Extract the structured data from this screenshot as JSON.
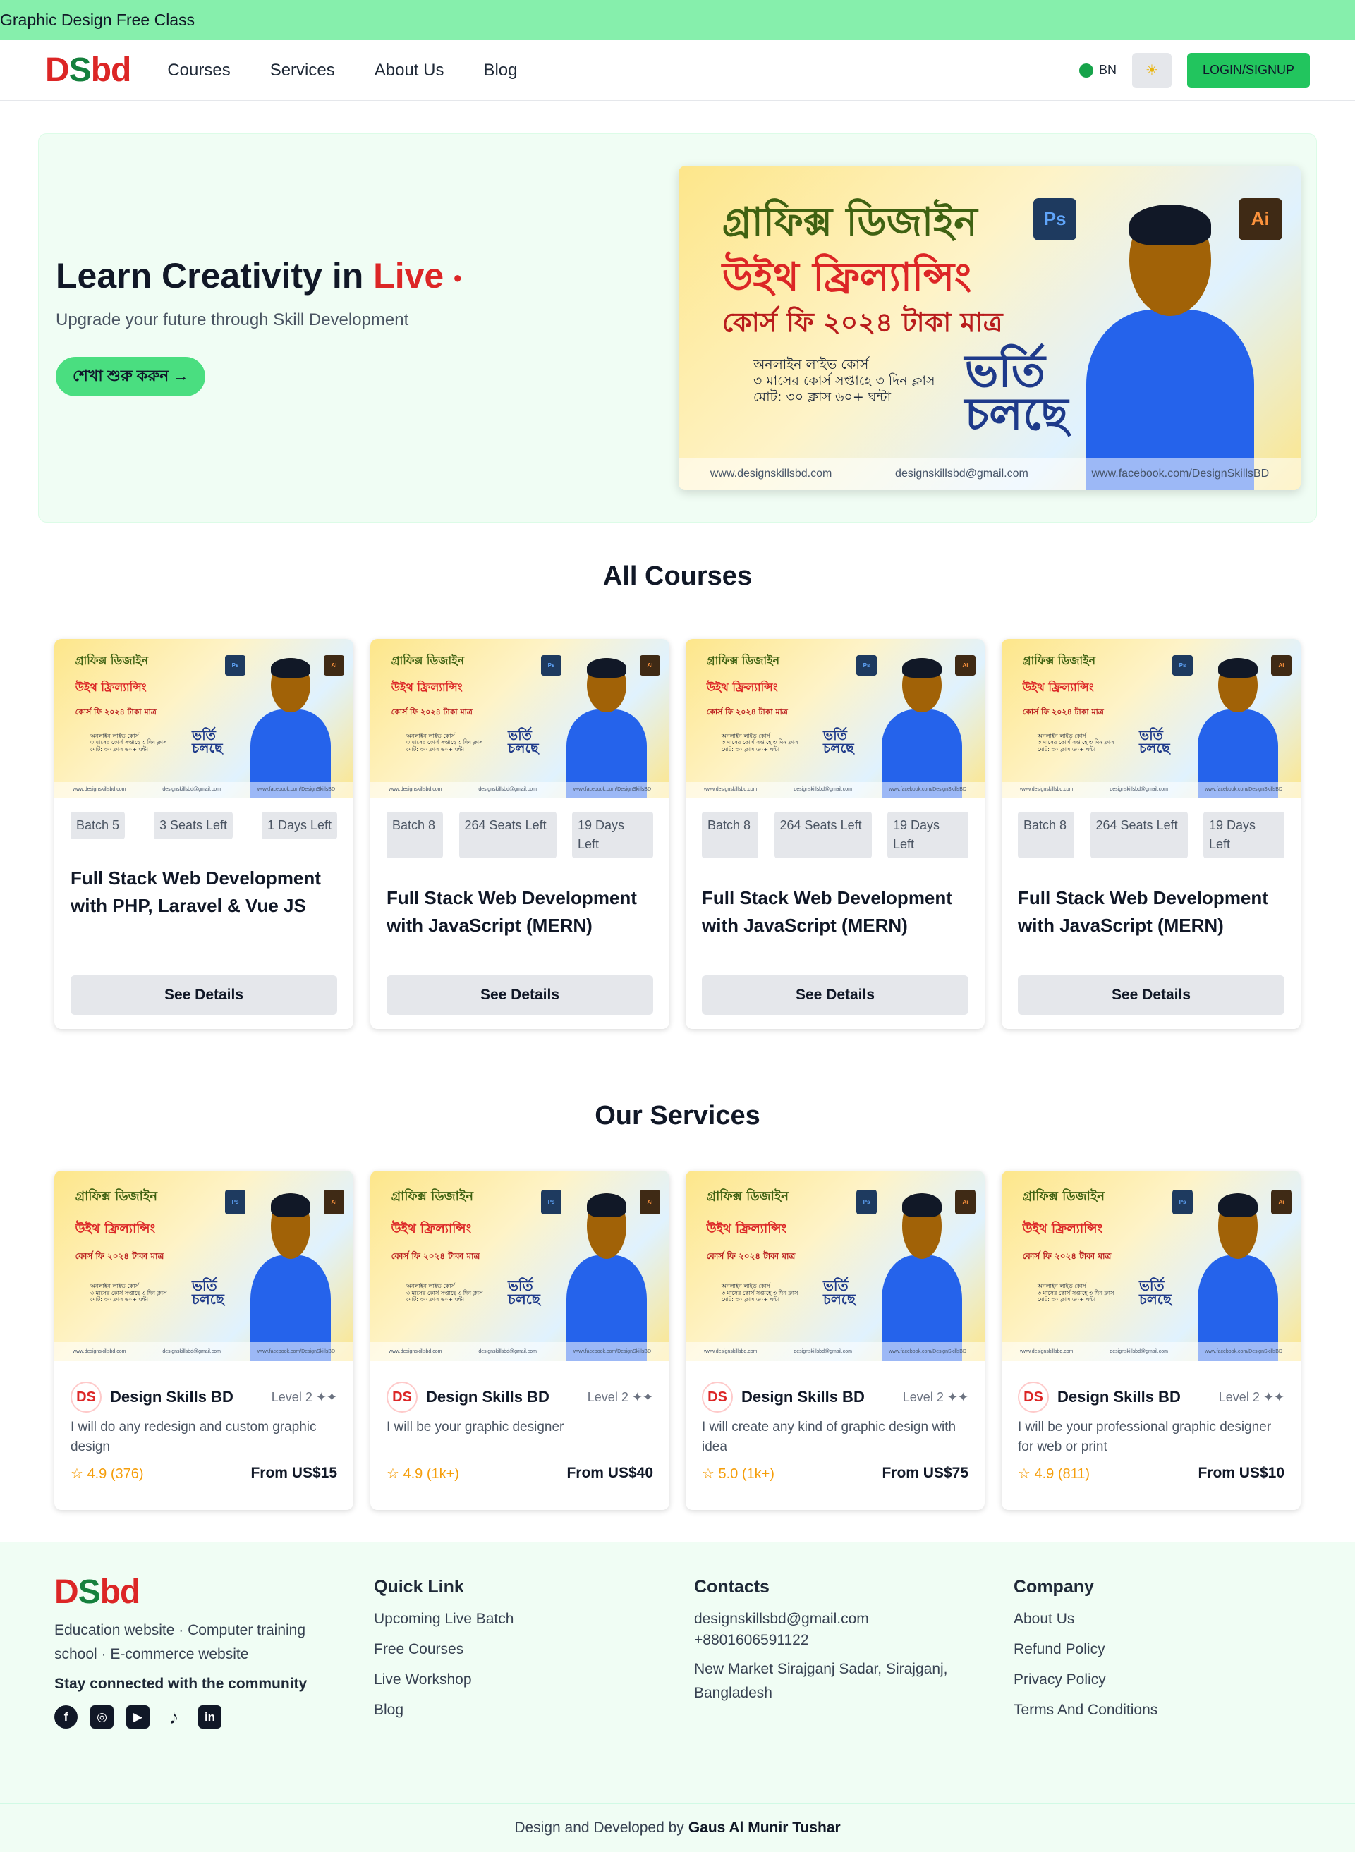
{
  "topbar": {
    "text": "Graphic Design Free Class"
  },
  "nav": {
    "logo": {
      "d": "D",
      "s": "S",
      "bd": "bd"
    },
    "links": [
      "Courses",
      "Services",
      "About Us",
      "Blog"
    ],
    "lang": "BN",
    "theme_icon": "☀",
    "login": "LOGIN/SIGNUP"
  },
  "hero": {
    "title_part1": "Learn Creativity in ",
    "title_live": "Live",
    "title_dot": "•",
    "subtitle": "Upgrade your future through Skill Development",
    "cta": "শেখা শুরু করুন →"
  },
  "banner": {
    "line1": "গ্রাফিক্স ডিজাইন",
    "line2": "উইথ ফ্রিল্যান্সিং",
    "line3": "কোর্স ফি ২০২৪ টাকা মাত্র",
    "line4a": "অনলাইন লাইভ কোর্স",
    "line4b": "৩ মাসের কোর্স সপ্তাহে ৩ দিন ক্লাস",
    "line4c": "মোট: ৩০ ক্লাস ৬০+ ঘন্টা",
    "admit1": "ভর্তি",
    "admit2": "চলছে",
    "ps": "Ps",
    "ai": "Ai",
    "foot1": "www.designskillsbd.com",
    "foot2": "designskillsbd@gmail.com",
    "foot3": "www.facebook.com/DesignSkillsBD"
  },
  "courses": {
    "title": "All Courses",
    "items": [
      {
        "batch": "Batch 5",
        "seats": "3 Seats Left",
        "days": "1 Days Left",
        "title": "Full Stack Web Development with PHP, Laravel & Vue JS",
        "button": "See Details"
      },
      {
        "batch": "Batch 8",
        "seats": "264 Seats Left",
        "days": "19 Days Left",
        "title": "Full Stack Web Development with JavaScript (MERN)",
        "button": "See Details"
      },
      {
        "batch": "Batch 8",
        "seats": "264 Seats Left",
        "days": "19 Days Left",
        "title": "Full Stack Web Development with JavaScript (MERN)",
        "button": "See Details"
      },
      {
        "batch": "Batch 8",
        "seats": "264 Seats Left",
        "days": "19 Days Left",
        "title": "Full Stack Web Development with JavaScript (MERN)",
        "button": "See Details"
      }
    ]
  },
  "services": {
    "title": "Our Services",
    "items": [
      {
        "seller": "Design Skills BD",
        "level": "Level 2 ✦✦",
        "desc": "I will do any redesign and custom graphic design",
        "rating": "☆ 4.9 (376)",
        "price": "From US$15"
      },
      {
        "seller": "Design Skills BD",
        "level": "Level 2 ✦✦",
        "desc": "I will be your graphic designer",
        "rating": "☆ 4.9 (1k+)",
        "price": "From US$40"
      },
      {
        "seller": "Design Skills BD",
        "level": "Level 2 ✦✦",
        "desc": "I will create any kind of graphic design with idea",
        "rating": "☆ 5.0 (1k+)",
        "price": "From US$75"
      },
      {
        "seller": "Design Skills BD",
        "level": "Level 2 ✦✦",
        "desc": "I will be your professional graphic designer for web or print",
        "rating": "☆ 4.9 (811)",
        "price": "From US$10"
      }
    ]
  },
  "footer": {
    "desc": "Education website · Computer training school · E-commerce website",
    "stay": "Stay connected with the community",
    "social": [
      "f",
      "◎",
      "▶",
      "♪",
      "in"
    ],
    "quick": {
      "title": "Quick Link",
      "links": [
        "Upcoming Live Batch",
        "Free Courses",
        "Live Workshop",
        "Blog"
      ]
    },
    "contacts": {
      "title": "Contacts",
      "email": "designskillsbd@gmail.com",
      "phone": "+8801606591122",
      "address": "New Market Sirajganj Sadar, Sirajganj, Bangladesh"
    },
    "company": {
      "title": "Company",
      "links": [
        "About Us",
        "Refund Policy",
        "Privacy Policy",
        "Terms And Conditions"
      ]
    },
    "credit_prefix": "Design and Developed by",
    "credit_name": "Gaus Al Munir Tushar"
  },
  "colors": {
    "accent": "#22c55e",
    "topbar": "#86efac",
    "live": "#dc2626",
    "footer_bg": "#f0fdf4"
  }
}
